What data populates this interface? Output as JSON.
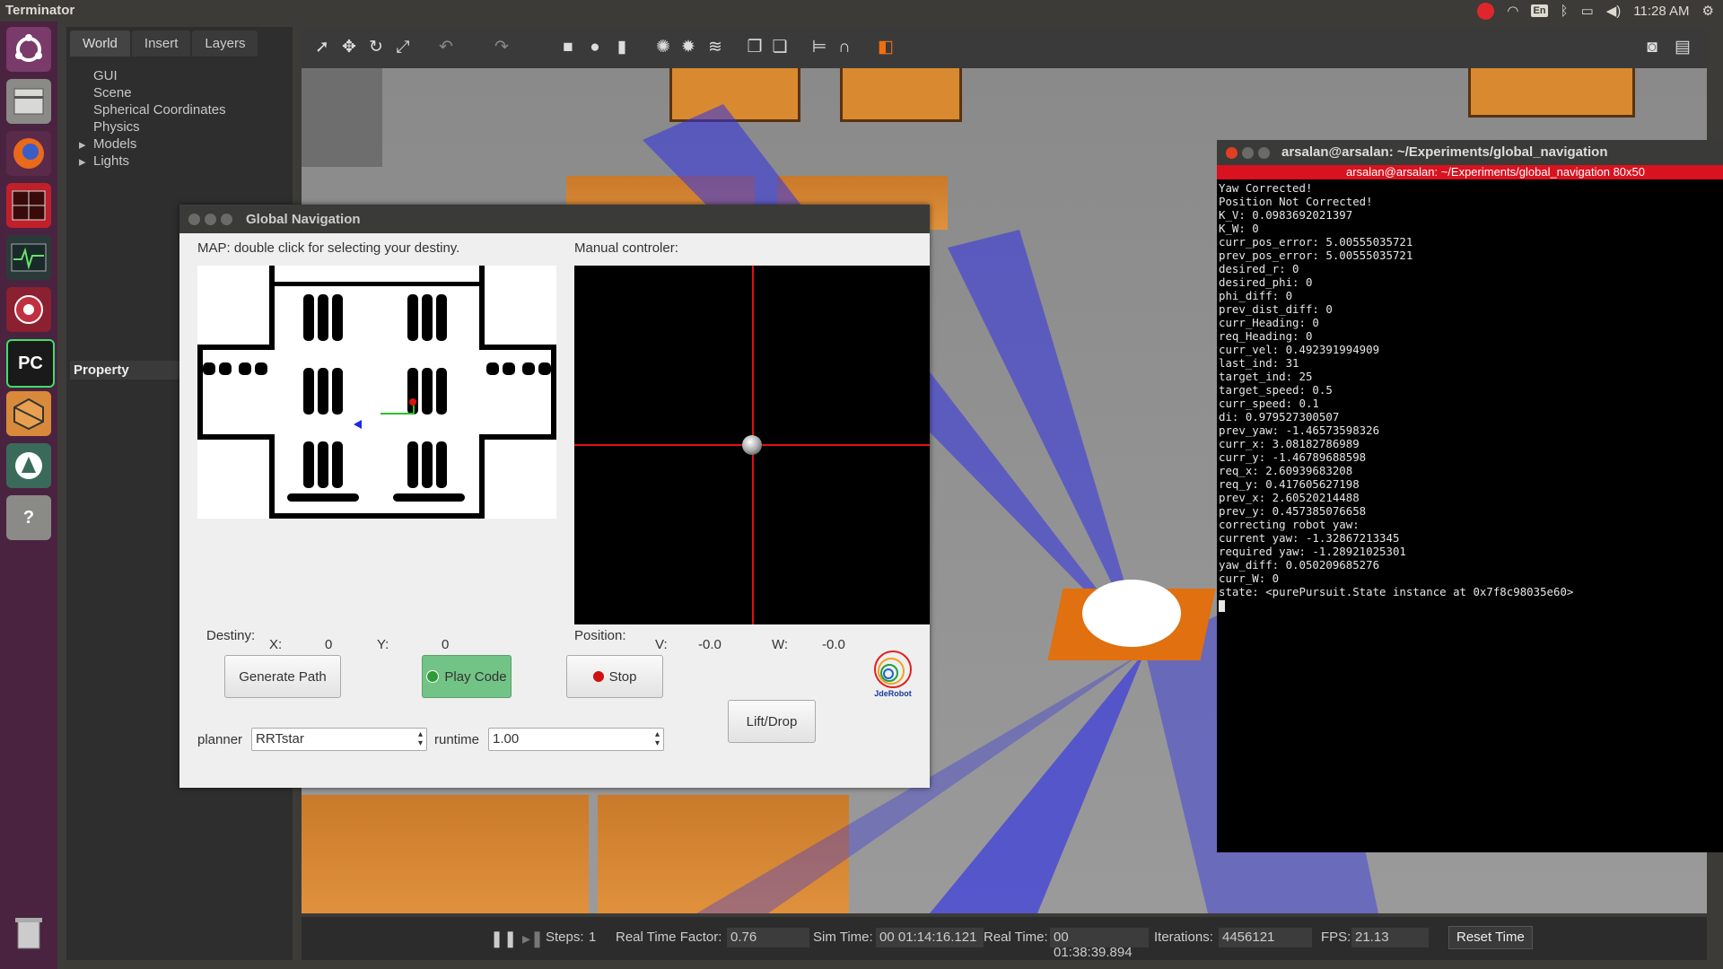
{
  "topbar": {
    "app_title": "Terminator",
    "keyboard_layout": "En",
    "time": "11:28 AM",
    "icons": [
      "record-icon",
      "wifi-icon",
      "keyboard-icon",
      "bluetooth-icon",
      "battery-icon",
      "volume-icon",
      "power-icon"
    ]
  },
  "launcher": {
    "items": [
      "ubuntu-dash-icon",
      "files-icon",
      "firefox-icon",
      "terminator-icon",
      "system-monitor-icon",
      "rviz-icon",
      "pycharm-icon",
      "gazebo-icon",
      "software-updater-icon",
      "help-icon",
      "trash-icon"
    ],
    "pycharm_label": "PC"
  },
  "gazebo": {
    "tabs": [
      "World",
      "Insert",
      "Layers"
    ],
    "tree": [
      "GUI",
      "Scene",
      "Spherical Coordinates",
      "Physics",
      "Models",
      "Lights"
    ],
    "property_label": "Property",
    "bottom": {
      "steps_label": "Steps:",
      "steps_value": "1",
      "rtf_label": "Real Time Factor:",
      "rtf_value": "0.76",
      "sim_time_label": "Sim Time:",
      "sim_time_value": "00 01:14:16.121",
      "real_time_label": "Real Time:",
      "real_time_value": "00 01:38:39.894",
      "iterations_label": "Iterations:",
      "iterations_value": "4456121",
      "fps_label": "FPS:",
      "fps_value": "21.13",
      "reset_label": "Reset Time"
    }
  },
  "gnav": {
    "title": "Global Navigation",
    "map_label": "MAP: double click for selecting your destiny.",
    "manual_label": "Manual controler:",
    "destiny_label": "Destiny:",
    "x_label": "X:",
    "x_value": "0",
    "y_label": "Y:",
    "y_value": "0",
    "position_label": "Position:",
    "v_label": "V:",
    "v_value": "-0.0",
    "w_label": "W:",
    "w_value": "-0.0",
    "generate_path": "Generate Path",
    "play_code": "Play Code",
    "stop": "Stop",
    "lift_drop": "Lift/Drop",
    "planner_label": "planner",
    "planner_value": "RRTstar",
    "runtime_label": "runtime",
    "runtime_value": "1.00",
    "logo_text": "JdeRobot",
    "colors": {
      "play": "#72c486",
      "stop_dot": "#d01010",
      "play_dot": "#2f9a3a"
    }
  },
  "terminal": {
    "window_title": "arsalan@arsalan: ~/Experiments/global_navigation",
    "tab_title": "arsalan@arsalan: ~/Experiments/global_navigation 80x50",
    "lines": [
      "Yaw Corrected!",
      "Position Not Corrected!",
      "K_V: 0.0983692021397",
      "K_W: 0",
      "curr_pos_error: 5.00555035721",
      "prev_pos_error: 5.00555035721",
      "desired_r: 0",
      "desired_phi: 0",
      "phi_diff: 0",
      "prev_dist_diff: 0",
      "curr_Heading: 0",
      "req_Heading: 0",
      "curr_vel: 0.492391994909",
      "last_ind: 31",
      "target_ind: 25",
      "target_speed: 0.5",
      "curr_speed: 0.1",
      "di: 0.979527300507",
      "prev_yaw: -1.46573598326",
      "curr_x: 3.08182786989",
      "curr_y: -1.46789688598",
      "req_x: 2.60939683208",
      "req_y: 0.417605627198",
      "prev_x: 2.60520214488",
      "prev_y: 0.457385076658",
      "correcting robot yaw:",
      "current yaw: -1.32867213345",
      "required yaw: -1.28921025301",
      "yaw_diff: 0.050209685276",
      "curr_W: 0",
      "state: <purePursuit.State instance at 0x7f8c98035e60>"
    ]
  }
}
